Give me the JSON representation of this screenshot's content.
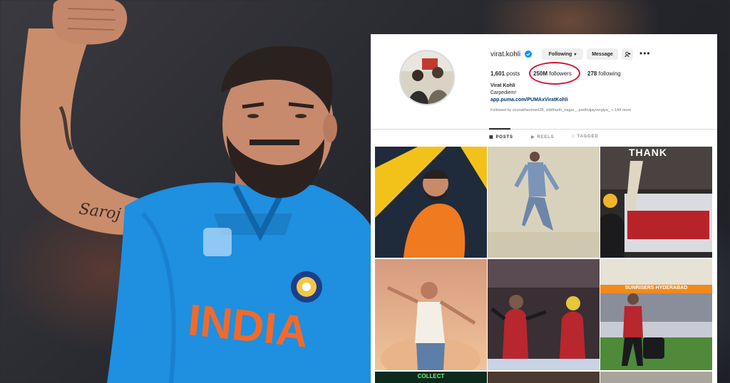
{
  "profile": {
    "username": "virat.kohli",
    "follow_button": "Following",
    "message_button": "Message",
    "more_label": "•••",
    "stats": {
      "posts_count": "1,601",
      "posts_label": "posts",
      "followers_count": "250M",
      "followers_label": "followers",
      "following_count": "278",
      "following_label": "following"
    },
    "bio": {
      "name": "Virat Kohli",
      "tagline": "Carpediem!",
      "link": "app.puma.com/PUMAxViratKohli"
    },
    "followed_by": "Followed by sourabhsomani28, siddharth_nagar_, parthvijayvergiya_ + 144 more"
  },
  "tabs": [
    {
      "label": "POSTS",
      "active": true
    },
    {
      "label": "REELS",
      "active": false
    },
    {
      "label": "TAGGED",
      "active": false
    }
  ],
  "grid": {
    "tile_texts": {
      "thank": "THANK",
      "sunrisers": "SUNRISERS HYDERABAD",
      "collect": "COLLECT"
    }
  },
  "jersey": {
    "text": "INDIA"
  },
  "tattoo": {
    "text": "Saroj"
  },
  "colors": {
    "jersey_blue": "#1f8fe0",
    "jersey_orange": "#f26a2a",
    "highlight_circle": "#d6183a",
    "verified_blue": "#0095f6"
  }
}
